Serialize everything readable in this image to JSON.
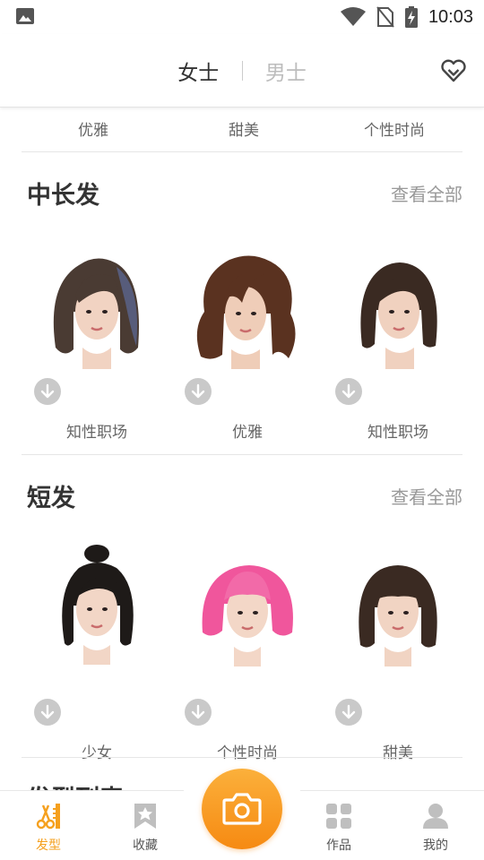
{
  "status_bar": {
    "time": "10:03",
    "icons": [
      "image-icon",
      "wifi-icon",
      "no-sim-icon",
      "battery-charging-icon"
    ]
  },
  "header": {
    "tabs": [
      {
        "label": "女士",
        "active": true
      },
      {
        "label": "男士",
        "active": false
      }
    ],
    "favorite_icon": "heart-icon"
  },
  "top_style_labels": [
    "优雅",
    "甜美",
    "个性时尚"
  ],
  "sections": [
    {
      "title": "中长发",
      "see_all": "查看全部",
      "items": [
        {
          "label": "知性职场",
          "hair_color": "#4a3b33",
          "style": "medium"
        },
        {
          "label": "优雅",
          "hair_color": "#5a3220",
          "style": "wavy"
        },
        {
          "label": "知性职场",
          "hair_color": "#3a2a22",
          "style": "bob"
        }
      ]
    },
    {
      "title": "短发",
      "see_all": "查看全部",
      "items": [
        {
          "label": "少女",
          "hair_color": "#1e1a18",
          "style": "bun"
        },
        {
          "label": "个性时尚",
          "hair_color": "#f0569c",
          "style": "pink-bob"
        },
        {
          "label": "甜美",
          "hair_color": "#3a2a22",
          "style": "bangs"
        }
      ]
    }
  ],
  "partial_section_title": "发型列表",
  "bottom_nav": {
    "items": [
      {
        "label": "发型",
        "icon": "hairstyle-icon",
        "active": true
      },
      {
        "label": "收藏",
        "icon": "bookmark-icon",
        "active": false
      },
      {
        "label": "作品",
        "icon": "grid-icon",
        "active": false
      },
      {
        "label": "我的",
        "icon": "user-icon",
        "active": false
      }
    ],
    "camera_icon": "camera-icon"
  },
  "colors": {
    "accent": "#f5a01e",
    "camera_gradient_top": "#fbb03b",
    "camera_gradient_bottom": "#f68a12",
    "download_icon_bg": "#c9c9c9"
  }
}
